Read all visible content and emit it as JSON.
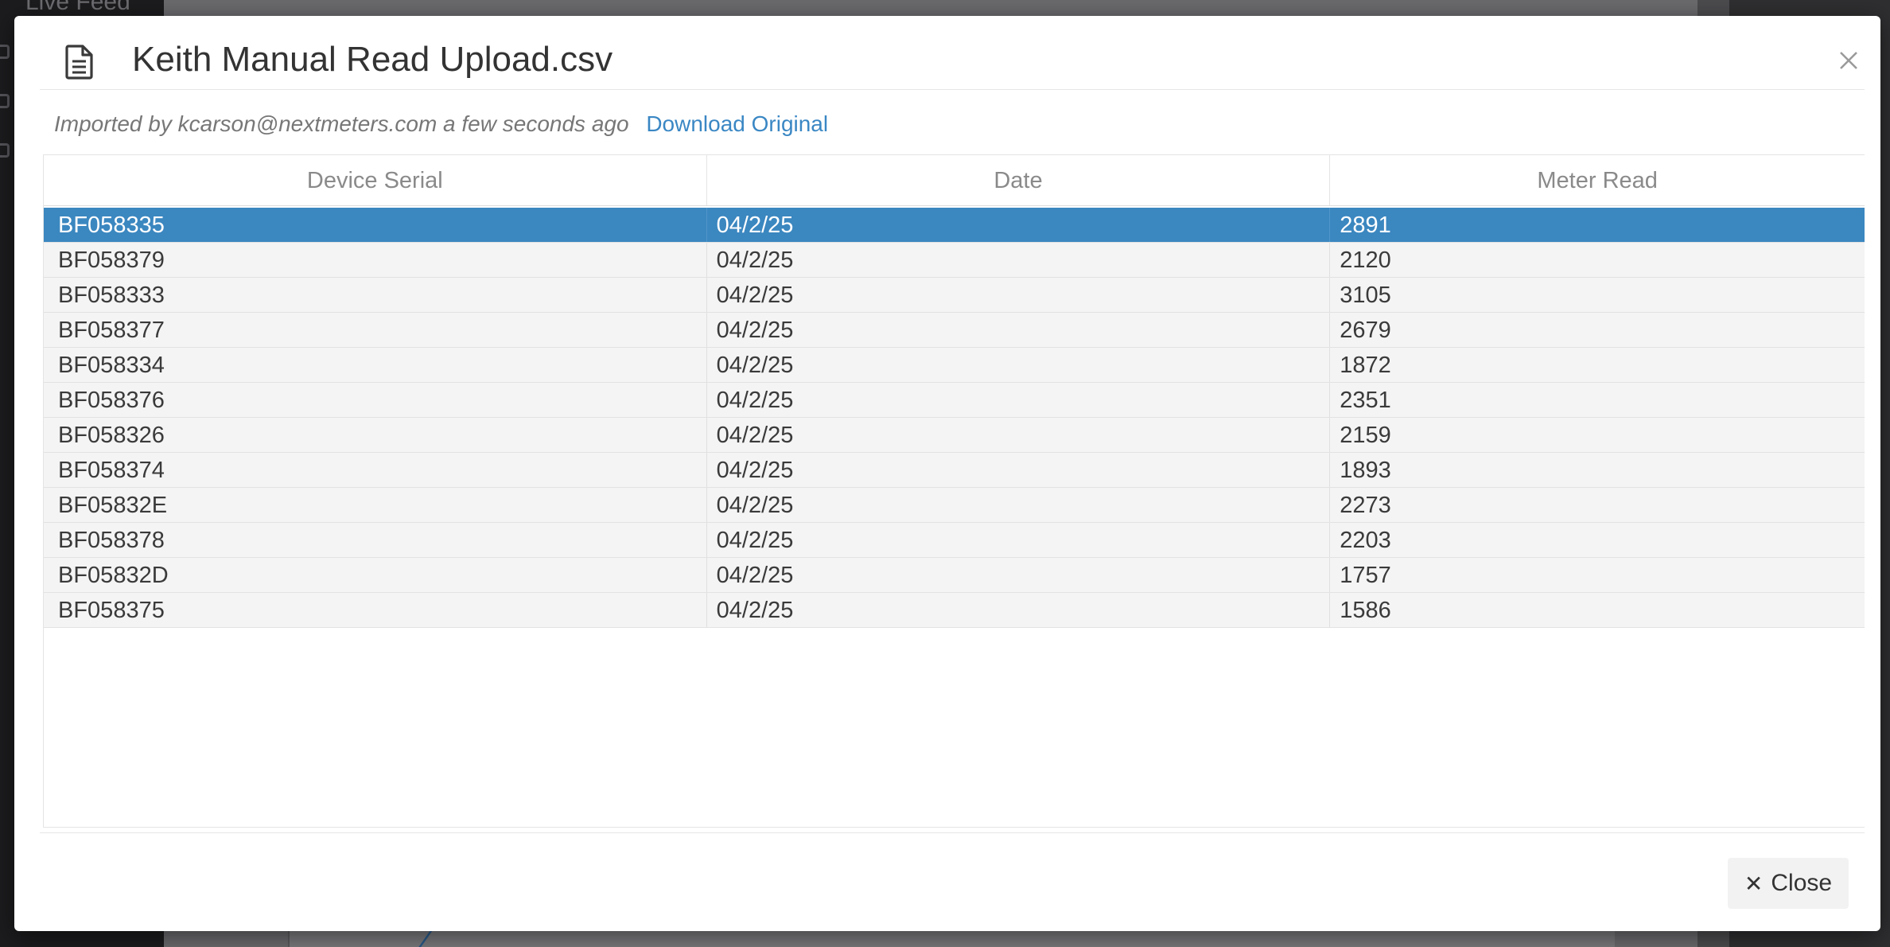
{
  "background": {
    "sidebar_item": "Live Feed"
  },
  "modal": {
    "title": "Keith Manual Read Upload.csv",
    "close_x_icon": "close-icon",
    "file_icon": "file-text-icon",
    "meta": {
      "imported_text": "Imported by kcarson@nextmeters.com a few seconds ago",
      "download_label": "Download Original"
    },
    "table": {
      "columns": [
        "Device Serial",
        "Date",
        "Meter Read"
      ],
      "rows": [
        {
          "serial": "BF058335",
          "date": "04/2/25",
          "read": "2891",
          "selected": true
        },
        {
          "serial": "BF058379",
          "date": "04/2/25",
          "read": "2120"
        },
        {
          "serial": "BF058333",
          "date": "04/2/25",
          "read": "3105"
        },
        {
          "serial": "BF058377",
          "date": "04/2/25",
          "read": "2679"
        },
        {
          "serial": "BF058334",
          "date": "04/2/25",
          "read": "1872"
        },
        {
          "serial": "BF058376",
          "date": "04/2/25",
          "read": "2351"
        },
        {
          "serial": "BF058326",
          "date": "04/2/25",
          "read": "2159"
        },
        {
          "serial": "BF058374",
          "date": "04/2/25",
          "read": "1893"
        },
        {
          "serial": "BF05832E",
          "date": "04/2/25",
          "read": "2273"
        },
        {
          "serial": "BF058378",
          "date": "04/2/25",
          "read": "2203"
        },
        {
          "serial": "BF05832D",
          "date": "04/2/25",
          "read": "1757"
        },
        {
          "serial": "BF058375",
          "date": "04/2/25",
          "read": "1586"
        }
      ]
    },
    "footer": {
      "close_label": "Close",
      "close_glyph": "✕"
    }
  },
  "colors": {
    "selected_row": "#3b87c0",
    "link": "#3a87c4",
    "row_background": "#f4f4f4"
  }
}
